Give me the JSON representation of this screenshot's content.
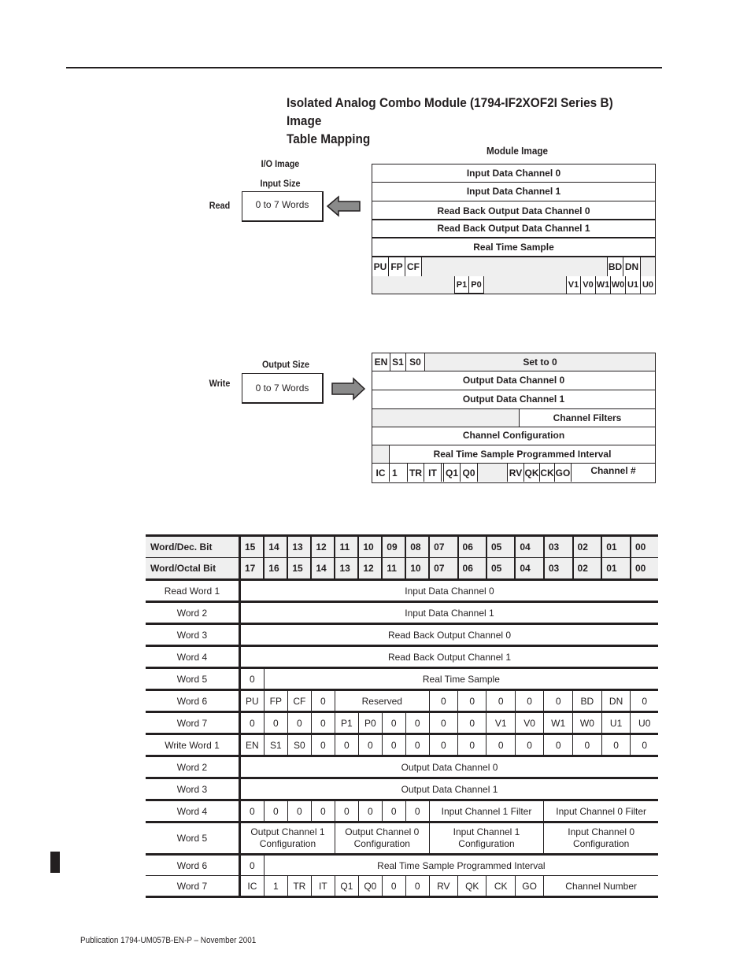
{
  "page": {
    "title": "Isolated Analog Combo Module (1794-IF2XOF2I Series B) Image Table Mapping",
    "title_line1": "Isolated Analog Combo Module (1794-IF2XOF2I Series B) Image",
    "title_line2": "Table Mapping",
    "footer": "Publication 1794-UM057B-EN-P – November 2001"
  },
  "diagram": {
    "module_image_label": "Module Image",
    "io_image_label": "I/O Image",
    "read": {
      "label": "Read",
      "size_label": "Input Size",
      "size_value": "0 to 7 Words",
      "arrow": "arrow-left-icon",
      "rows": [
        "Input Data Channel 0",
        "Input Data Channel 1",
        "Read Back Output Data Channel 0",
        "Read Back Output Data Channel 1",
        "Real Time Sample"
      ],
      "status_row1": [
        "PU",
        "FP",
        "CF",
        "BD",
        "DN"
      ],
      "status_row2": [
        "P1",
        "P0",
        "V1",
        "V0",
        "W1",
        "W0",
        "U1",
        "U0"
      ]
    },
    "write": {
      "label": "Write",
      "size_label": "Output Size",
      "size_value": "0 to 7 Words",
      "arrow": "arrow-right-icon",
      "row1": [
        "EN",
        "S1",
        "S0",
        "Set to 0"
      ],
      "rows": [
        "Output Data Channel 0",
        "Output Data Channel 1",
        "Channel Filters",
        "Channel Configuration",
        "Real Time Sample Programmed Interval"
      ],
      "control_row": [
        "IC",
        "1",
        "TR",
        "IT",
        "Q1",
        "Q0",
        "RV",
        "QK",
        "CK",
        "GO",
        "Channel #"
      ]
    }
  },
  "table": {
    "header_dec": {
      "label": "Word/Dec. Bit",
      "bits": [
        "15",
        "14",
        "13",
        "12",
        "11",
        "10",
        "09",
        "08",
        "07",
        "06",
        "05",
        "04",
        "03",
        "02",
        "01",
        "00"
      ]
    },
    "header_oct": {
      "label": "Word/Octal Bit",
      "bits": [
        "17",
        "16",
        "15",
        "14",
        "13",
        "12",
        "11",
        "10",
        "07",
        "06",
        "05",
        "04",
        "03",
        "02",
        "01",
        "00"
      ]
    },
    "read_rows": [
      {
        "word": "Read Word 1",
        "cells": [
          {
            "text": "Input Data Channel 0",
            "span": 16
          }
        ]
      },
      {
        "word": "Word 2",
        "cells": [
          {
            "text": "Input Data Channel 1",
            "span": 16
          }
        ]
      },
      {
        "word": "Word 3",
        "cells": [
          {
            "text": "Read Back Output Channel 0",
            "span": 16
          }
        ]
      },
      {
        "word": "Word 4",
        "cells": [
          {
            "text": "Read Back Output Channel 1",
            "span": 16
          }
        ]
      },
      {
        "word": "Word 5",
        "cells": [
          {
            "text": "0",
            "span": 1
          },
          {
            "text": "Real Time Sample",
            "span": 15
          }
        ]
      },
      {
        "word": "Word 6",
        "cells": [
          {
            "text": "PU",
            "span": 1
          },
          {
            "text": "FP",
            "span": 1
          },
          {
            "text": "CF",
            "span": 1
          },
          {
            "text": "0",
            "span": 1
          },
          {
            "text": "Reserved",
            "span": 4
          },
          {
            "text": "0",
            "span": 1
          },
          {
            "text": "0",
            "span": 1
          },
          {
            "text": "0",
            "span": 1
          },
          {
            "text": "0",
            "span": 1
          },
          {
            "text": "0",
            "span": 1
          },
          {
            "text": "BD",
            "span": 1
          },
          {
            "text": "DN",
            "span": 1
          },
          {
            "text": "0",
            "span": 1
          }
        ]
      },
      {
        "word": "Word 7",
        "cells": [
          {
            "text": "0",
            "span": 1
          },
          {
            "text": "0",
            "span": 1
          },
          {
            "text": "0",
            "span": 1
          },
          {
            "text": "0",
            "span": 1
          },
          {
            "text": "P1",
            "span": 1
          },
          {
            "text": "P0",
            "span": 1
          },
          {
            "text": "0",
            "span": 1
          },
          {
            "text": "0",
            "span": 1
          },
          {
            "text": "0",
            "span": 1
          },
          {
            "text": "0",
            "span": 1
          },
          {
            "text": "V1",
            "span": 1
          },
          {
            "text": "V0",
            "span": 1
          },
          {
            "text": "W1",
            "span": 1
          },
          {
            "text": "W0",
            "span": 1
          },
          {
            "text": "U1",
            "span": 1
          },
          {
            "text": "U0",
            "span": 1
          }
        ]
      }
    ],
    "write_rows": [
      {
        "word": "Write Word 1",
        "cells": [
          {
            "text": "EN",
            "span": 1
          },
          {
            "text": "S1",
            "span": 1
          },
          {
            "text": "S0",
            "span": 1
          },
          {
            "text": "0",
            "span": 1
          },
          {
            "text": "0",
            "span": 1
          },
          {
            "text": "0",
            "span": 1
          },
          {
            "text": "0",
            "span": 1
          },
          {
            "text": "0",
            "span": 1
          },
          {
            "text": "0",
            "span": 1
          },
          {
            "text": "0",
            "span": 1
          },
          {
            "text": "0",
            "span": 1
          },
          {
            "text": "0",
            "span": 1
          },
          {
            "text": "0",
            "span": 1
          },
          {
            "text": "0",
            "span": 1
          },
          {
            "text": "0",
            "span": 1
          },
          {
            "text": "0",
            "span": 1
          }
        ]
      },
      {
        "word": "Word 2",
        "cells": [
          {
            "text": "Output Data Channel 0",
            "span": 16
          }
        ]
      },
      {
        "word": "Word 3",
        "cells": [
          {
            "text": "Output Data Channel 1",
            "span": 16
          }
        ]
      },
      {
        "word": "Word 4",
        "cells": [
          {
            "text": "0",
            "span": 1
          },
          {
            "text": "0",
            "span": 1
          },
          {
            "text": "0",
            "span": 1
          },
          {
            "text": "0",
            "span": 1
          },
          {
            "text": "0",
            "span": 1
          },
          {
            "text": "0",
            "span": 1
          },
          {
            "text": "0",
            "span": 1
          },
          {
            "text": "0",
            "span": 1
          },
          {
            "text": "Input Channel 1 Filter",
            "span": 4
          },
          {
            "text": "Input Channel 0 Filter",
            "span": 4
          }
        ]
      },
      {
        "word": "Word 5",
        "tall": true,
        "cells": [
          {
            "text": "Output Channel 1\nConfiguration",
            "span": 4
          },
          {
            "text": "Output Channel 0\nConfiguration",
            "span": 4
          },
          {
            "text": "Input Channel 1\nConfiguration",
            "span": 4
          },
          {
            "text": "Input Channel 0\nConfiguration",
            "span": 4
          }
        ]
      },
      {
        "word": "Word 6",
        "cells": [
          {
            "text": "0",
            "span": 1
          },
          {
            "text": "Real Time Sample Programmed Interval",
            "span": 15
          }
        ]
      },
      {
        "word": "Word 7",
        "cells": [
          {
            "text": "IC",
            "span": 1
          },
          {
            "text": "1",
            "span": 1
          },
          {
            "text": "TR",
            "span": 1
          },
          {
            "text": "IT",
            "span": 1
          },
          {
            "text": "Q1",
            "span": 1
          },
          {
            "text": "Q0",
            "span": 1
          },
          {
            "text": "0",
            "span": 1
          },
          {
            "text": "0",
            "span": 1
          },
          {
            "text": "RV",
            "span": 1
          },
          {
            "text": "QK",
            "span": 1
          },
          {
            "text": "CK",
            "span": 1
          },
          {
            "text": "GO",
            "span": 1
          },
          {
            "text": "Channel Number",
            "span": 4
          }
        ]
      }
    ]
  }
}
